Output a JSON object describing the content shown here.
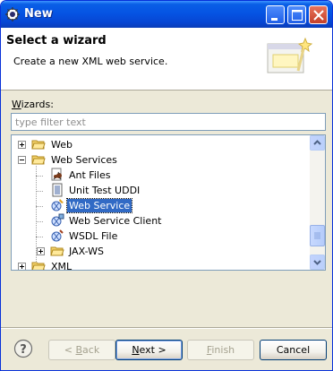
{
  "window": {
    "title": "New",
    "controls": [
      "minimize-icon",
      "maximize-icon",
      "close-icon"
    ]
  },
  "header": {
    "title": "Select a wizard",
    "description": "Create a new XML web service."
  },
  "wizards": {
    "label_prefix": "W",
    "label_rest": "izards:",
    "filter_placeholder": "type filter text"
  },
  "tree": {
    "items": [
      {
        "label": "Web",
        "icon": "folder-icon",
        "expander": "plus"
      },
      {
        "label": "Web Services",
        "icon": "folder-open-icon",
        "expander": "minus"
      },
      {
        "label": "Ant Files",
        "icon": "ant-icon"
      },
      {
        "label": "Unit Test UDDI",
        "icon": "uddi-icon"
      },
      {
        "label": "Web Service",
        "icon": "web-service-icon",
        "selected": true
      },
      {
        "label": "Web Service Client",
        "icon": "web-service-client-icon"
      },
      {
        "label": "WSDL File",
        "icon": "wsdl-icon"
      },
      {
        "label": "JAX-WS",
        "icon": "folder-icon",
        "expander": "plus"
      },
      {
        "label": "XML",
        "icon": "folder-icon",
        "expander": "plus"
      }
    ]
  },
  "buttons": {
    "back": {
      "mnemonic": "B",
      "rest": "ack",
      "prefix": "< "
    },
    "next": {
      "mnemonic": "N",
      "rest": "ext >"
    },
    "finish": {
      "mnemonic": "F",
      "rest": "inish"
    },
    "cancel": "Cancel"
  },
  "colors": {
    "title_bar": "#0554e3",
    "selection": "#316ac5",
    "dialog_bg": "#ece9d8"
  }
}
